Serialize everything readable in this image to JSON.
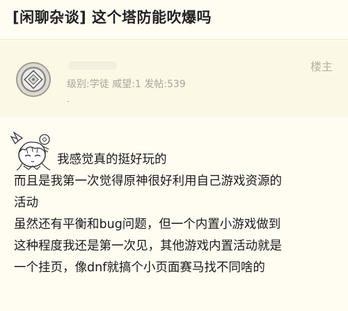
{
  "thread": {
    "title": "[闲聊杂谈] 这个塔防能吹爆吗"
  },
  "post": {
    "author": {
      "role_badge": "楼主",
      "stats": "级别:学徒  威望:1  发帖:539",
      "sub": "-"
    },
    "body_lines": [
      "我感觉真的挺好玩的",
      "而且是我第一次觉得原神很好利用自己游戏资源的",
      "活动",
      "虽然还有平衡和bug问题，但一个内置小游戏做到",
      "这种程度我还是第一次见，其他游戏内置活动就是",
      "一个挂页，像dnf就搞个小页面赛马找不同啥的"
    ]
  },
  "icons": {
    "avatar": "default-avatar-icon",
    "sticker": "chibi-girl-sticker-icon"
  }
}
